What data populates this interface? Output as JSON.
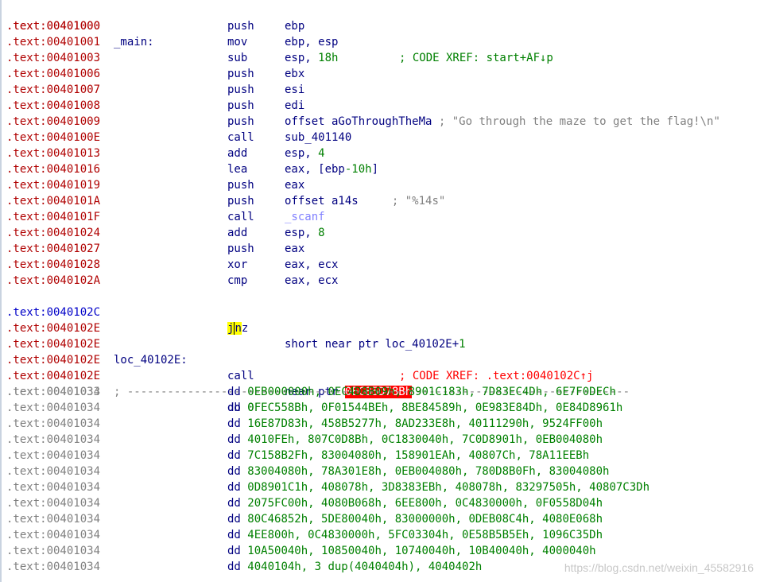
{
  "listing": {
    "main_addr": ".text:00401000",
    "main_label": "_main:",
    "main_xref": "; CODE XREF: start+AF↓p",
    "code": [
      {
        "addr": ".text:00401000",
        "mnem": "push",
        "ops": "ebp"
      },
      {
        "addr": ".text:00401001",
        "mnem": "mov",
        "ops": "ebp, esp"
      },
      {
        "addr": ".text:00401003",
        "mnem": "sub",
        "ops_a": "esp, ",
        "ops_num": "18h"
      },
      {
        "addr": ".text:00401006",
        "mnem": "push",
        "ops": "ebx"
      },
      {
        "addr": ".text:00401007",
        "mnem": "push",
        "ops": "esi"
      },
      {
        "addr": ".text:00401008",
        "mnem": "push",
        "ops": "edi"
      },
      {
        "addr": ".text:00401009",
        "mnem": "push",
        "ops": "offset aGoThroughTheMa",
        "comment": "; \"Go through the maze to get the flag!\\n\""
      },
      {
        "addr": ".text:0040100E",
        "mnem": "call",
        "ops": "sub_401140"
      },
      {
        "addr": ".text:00401013",
        "mnem": "add",
        "ops_a": "esp, ",
        "ops_num": "4"
      },
      {
        "addr": ".text:00401016",
        "mnem": "lea",
        "ops_a": "eax, [ebp",
        "ops_num": "-10h",
        "ops_b": "]"
      },
      {
        "addr": ".text:00401019",
        "mnem": "push",
        "ops": "eax"
      },
      {
        "addr": ".text:0040101A",
        "mnem": "push",
        "ops": "offset a14s",
        "comment": "; \"%14s\""
      },
      {
        "addr": ".text:0040101F",
        "mnem": "call",
        "imp": "_scanf"
      },
      {
        "addr": ".text:00401024",
        "mnem": "add",
        "ops_a": "esp, ",
        "ops_num": "8"
      },
      {
        "addr": ".text:00401027",
        "mnem": "push",
        "ops": "eax"
      },
      {
        "addr": ".text:00401028",
        "mnem": "xor",
        "ops": "eax, ecx"
      },
      {
        "addr": ".text:0040102A",
        "mnem": "cmp",
        "ops": "eax, ecx"
      }
    ],
    "jnz": {
      "addr": ".text:0040102C",
      "mnem_a": "j",
      "mnem_hl": "n",
      "mnem_b": "z",
      "ops_a": "short near ptr loc_40102E+",
      "ops_num": "1"
    },
    "blank_addr": ".text:0040102E",
    "loc": {
      "addr": ".text:0040102E",
      "label": "loc_40102E:",
      "xref": "; CODE XREF: .text:0040102C↑j"
    },
    "call_bad": {
      "addr": ".text:0040102E",
      "mnem": "call",
      "ops": "near ptr ",
      "target": "0EC85D78Bh"
    },
    "sep": {
      "addr": ".text:0040102E",
      "text": "; ---------------------------------------------------------------------------"
    },
    "db": {
      "addr": ".text:00401033",
      "kw": "db ",
      "val": "0"
    },
    "dd_rows": [
      {
        "addr": ".text:00401034",
        "kw": "dd ",
        "val": "0EB000000h, 0EC4D8B09h, 8901C183h, 7D83EC4Dh, 6E7F0DECh"
      },
      {
        "addr": ".text:00401034",
        "kw": "dd ",
        "val": "0FEC558Bh, 0F01544BEh, 8BE84589h, 0E983E84Dh, 0E84D8961h"
      },
      {
        "addr": ".text:00401034",
        "kw": "dd ",
        "val": "16E87D83h, 458B5277h, 8AD233E8h, 40111290h, 9524FF00h"
      },
      {
        "addr": ".text:00401034",
        "kw": "dd ",
        "val": "4010FEh, 807C0D8Bh, 0C1830040h, 7C0D8901h, 0EB004080h"
      },
      {
        "addr": ".text:00401034",
        "kw": "dd ",
        "val": "7C158B2Fh, 83004080h, 158901EAh, 40807Ch, 78A11EEBh"
      },
      {
        "addr": ".text:00401034",
        "kw": "dd ",
        "val": "83004080h, 78A301E8h, 0EB004080h, 780D8B0Fh, 83004080h"
      },
      {
        "addr": ".text:00401034",
        "kw": "dd ",
        "val": "0D8901C1h, 408078h, 3D8383EBh, 408078h, 83297505h, 40807C3Dh"
      },
      {
        "addr": ".text:00401034",
        "kw": "dd ",
        "val": "2075FC00h, 4080B068h, 6EE800h, 0C4830000h, 0F0558D04h"
      },
      {
        "addr": ".text:00401034",
        "kw": "dd ",
        "val": "80C46852h, 5DE80040h, 83000000h, 0DEB08C4h, 4080E068h"
      },
      {
        "addr": ".text:00401034",
        "kw": "dd ",
        "val": "4EE800h, 0C4830000h, 5FC03304h, 0E58B5B5Eh, 1096C35Dh"
      },
      {
        "addr": ".text:00401034",
        "kw": "dd ",
        "val": "10A50040h, 10850040h, 10740040h, 10B40040h, 4000040h"
      },
      {
        "addr": ".text:00401034",
        "kw": "dd ",
        "val": "4040104h, 3 dup(4040404h), 4040402h"
      }
    ]
  },
  "watermark": "https://blog.csdn.net/weixin_45582916"
}
